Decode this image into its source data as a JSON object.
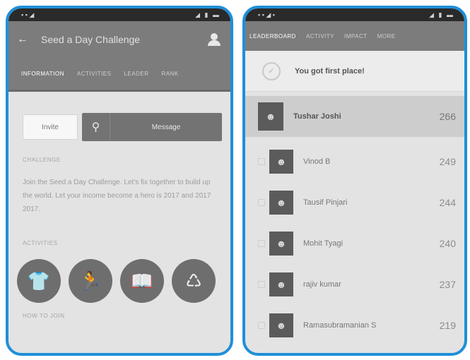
{
  "left": {
    "title": "Seed a Day Challenge",
    "tabs": [
      "Information",
      "Activities",
      "Leader",
      "Rank"
    ],
    "invite_label": "Invite",
    "message_label": "Message",
    "challenge_heading": "Challenge",
    "challenge_text": "Join the Seed a Day Challenge. Let's fix together to build up the world. Let your income become a hero is 2017 and 2017 2017.",
    "activities_heading": "Activities",
    "howto_heading": "How to join",
    "activity_icons": [
      "tshirt-icon",
      "runner-icon",
      "book-icon",
      "recycle-icon"
    ]
  },
  "right": {
    "tabs": [
      "Leaderboard",
      "Activity",
      "Impact",
      "More"
    ],
    "first_place_text": "You got first place!",
    "leaderboard": [
      {
        "name": "Tushar Joshi",
        "score": "266"
      },
      {
        "name": "Vinod B",
        "score": "249"
      },
      {
        "name": "Tausif Pinjari",
        "score": "244"
      },
      {
        "name": "Mohit Tyagi",
        "score": "240"
      },
      {
        "name": "rajiv kumar",
        "score": "237"
      },
      {
        "name": "Ramasubramanian S",
        "score": "219"
      }
    ]
  },
  "colors": {
    "frame_border": "#1f8fd8",
    "appbar": "#7c7c7c",
    "statusbar": "#2a2a2a"
  }
}
